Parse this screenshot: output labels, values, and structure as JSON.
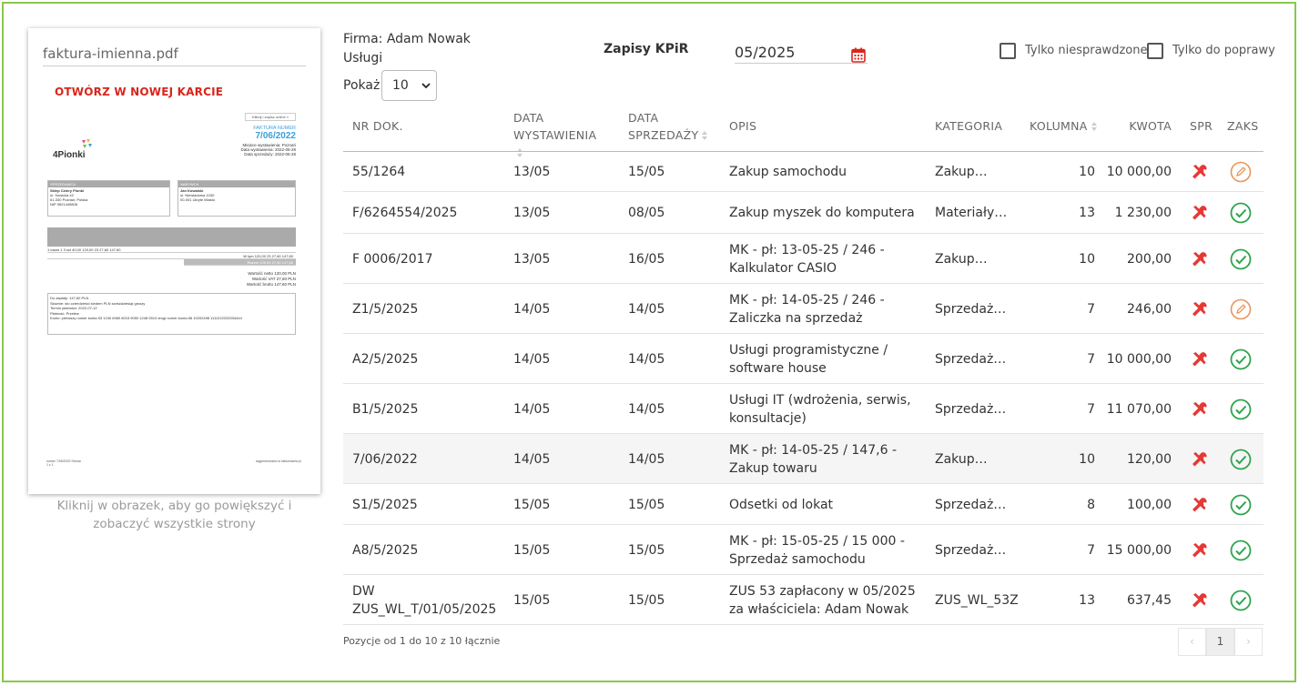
{
  "preview": {
    "filename": "faktura-imienna.pdf",
    "open_new_tab": "OTWÓRZ W NOWEJ KARCIE",
    "caption": "Kliknij w obrazek, aby go powiększyć i zobaczyć wszystkie strony",
    "doc": {
      "button": "Kliknij i zapisz online »",
      "invoice_label": "FAKTURA NUMER",
      "invoice_number": "7/06/2022",
      "dates": [
        "Miejsce wystawienia: Poznań",
        "Data wystawienia: 2022-06-28",
        "Data sprzedaży: 2022-06-28"
      ],
      "logo": "4Pionki",
      "seller_header": "SPRZEDAWCA",
      "seller_lines": [
        "Sklep Cztery Pionki",
        "ul. Sowicka 42",
        "61-330 Poznań, Polska",
        "NIP 9521449808"
      ],
      "buyer_header": "NABYWCA",
      "buyer_lines": [
        "Jan Kowalski",
        "ul. Niewiadoma 1030",
        "00-001 Ukryte Miasto"
      ],
      "item_row": "1   towar 1   3 szt   40,00   120,00   23   27,60   147,60",
      "w_tym_row": "W tym   120,00   23   27,60   147,60",
      "razem_row": "Razem   120,00   27,60   147,60",
      "sums": [
        "Wartość netto   120,00 PLN",
        "Wartość VAT   27,60 PLN",
        "Wartość brutto   147,60 PLN"
      ],
      "pay_lines": [
        "Do zapłaty:   147,60 PLN",
        "Słownie: sto czterdzieści siedem PLN sześćdziesiąt groszy",
        "Termin płatności:   2022-07-12",
        "Płatność:   Przelew",
        "Konto:   pierwszy numer konta 53 1240 6960 6015 9050 1248 0510 drugi numer konta 88 10202498 1111222233334444"
      ],
      "footer_left": "numer 7/06/2022 Strona 1 z 1",
      "footer_right": "wygenerowano w fakturownia.pl"
    }
  },
  "header": {
    "firma": "Firma: Adam Nowak",
    "subtitle": "Usługi",
    "show_label": "Pokaż",
    "page_size": "10",
    "title": "Zapisy KPiR",
    "period": "05/2025",
    "filter_unchecked": "Tylko niesprawdzone",
    "filter_fix": "Tylko do poprawy"
  },
  "table": {
    "columns": {
      "nr": "NR DOK.",
      "wyst": "DATA WYSTAWIENIA",
      "sprz": "DATA SPRZEDAŻY",
      "opis": "OPIS",
      "kat": "KATEGORIA",
      "kol": "KOLUMNA",
      "kwota": "KWOTA",
      "spr": "SPR",
      "zaks": "ZAKS"
    },
    "rows": [
      {
        "nr": "55/1264",
        "wyst": "13/05",
        "sprz": "15/05",
        "opis": "Zakup samochodu",
        "kat": "Zakup…",
        "kol": "10",
        "kwota": "10 000,00",
        "zaks": "edit"
      },
      {
        "nr": "F/6264554/2025",
        "wyst": "13/05",
        "sprz": "08/05",
        "opis": "Zakup myszek do komputera",
        "kat": "Materiały…",
        "kol": "13",
        "kwota": "1 230,00",
        "zaks": "ok"
      },
      {
        "nr": "F 0006/2017",
        "wyst": "13/05",
        "sprz": "16/05",
        "opis": "MK - pł: 13-05-25 / 246 - Kalkulator CASIO",
        "kat": "Zakup…",
        "kol": "10",
        "kwota": "200,00",
        "zaks": "ok"
      },
      {
        "nr": "Z1/5/2025",
        "wyst": "14/05",
        "sprz": "14/05",
        "opis": "MK - pł: 14-05-25 / 246 - Zaliczka na sprzedaż",
        "kat": "Sprzedaż…",
        "kol": "7",
        "kwota": "246,00",
        "zaks": "edit"
      },
      {
        "nr": "A2/5/2025",
        "wyst": "14/05",
        "sprz": "14/05",
        "opis": "Usługi programistyczne / software house",
        "kat": "Sprzedaż…",
        "kol": "7",
        "kwota": "10 000,00",
        "zaks": "ok"
      },
      {
        "nr": "B1/5/2025",
        "wyst": "14/05",
        "sprz": "14/05",
        "opis": "Usługi IT (wdrożenia, serwis, konsultacje)",
        "kat": "Sprzedaż…",
        "kol": "7",
        "kwota": "11 070,00",
        "zaks": "ok"
      },
      {
        "nr": "7/06/2022",
        "wyst": "14/05",
        "sprz": "14/05",
        "opis": "MK - pł: 14-05-25 / 147,6 - Zakup towaru",
        "kat": "Zakup…",
        "kol": "10",
        "kwota": "120,00",
        "zaks": "ok"
      },
      {
        "nr": "S1/5/2025",
        "wyst": "15/05",
        "sprz": "15/05",
        "opis": "Odsetki od lokat",
        "kat": "Sprzedaż…",
        "kol": "8",
        "kwota": "100,00",
        "zaks": "ok"
      },
      {
        "nr": "A8/5/2025",
        "wyst": "15/05",
        "sprz": "15/05",
        "opis": "MK - pł: 15-05-25 / 15 000 - Sprzedaż samochodu",
        "kat": "Sprzedaż…",
        "kol": "7",
        "kwota": "15 000,00",
        "zaks": "ok"
      },
      {
        "nr": "DW ZUS_WL_T/01/05/2025",
        "wyst": "15/05",
        "sprz": "15/05",
        "opis": "ZUS 53 zapłacony w 05/2025 za właściciela: Adam Nowak",
        "kat": "ZUS_WL_53Z",
        "kol": "13",
        "kwota": "637,45",
        "zaks": "ok"
      }
    ]
  },
  "footer": {
    "info": "Pozycje od 1 do 10 z 10 łącznie",
    "prev": "‹",
    "page": "1",
    "next": "›"
  },
  "colors": {
    "frame": "#8ac84b",
    "accent_red": "#d9261c",
    "ok_green": "#2ea44f",
    "edit_orange": "#e8955a",
    "tool_red": "#e53935"
  }
}
